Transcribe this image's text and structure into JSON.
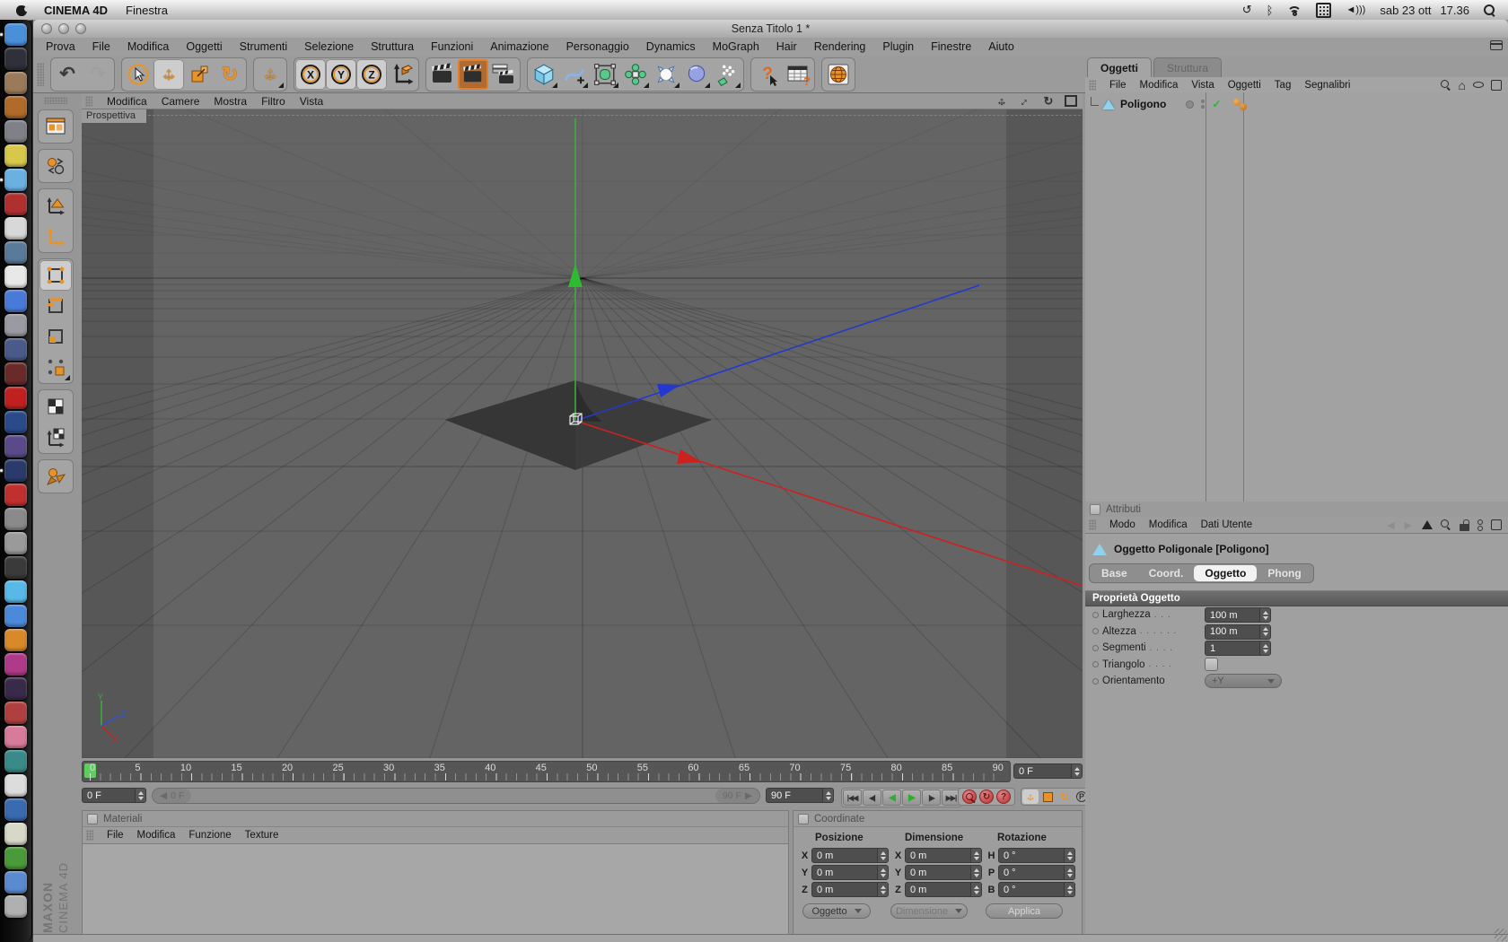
{
  "menubar": {
    "app_name": "CINEMA 4D",
    "menu": "Finestra",
    "date": "sab 23 ott",
    "time": "17.36"
  },
  "window": {
    "title": "Senza Titolo 1 *"
  },
  "main_menu": [
    "Prova",
    "File",
    "Modifica",
    "Oggetti",
    "Strumenti",
    "Selezione",
    "Struttura",
    "Funzioni",
    "Animazione",
    "Personaggio",
    "Dynamics",
    "MoGraph",
    "Hair",
    "Rendering",
    "Plugin",
    "Finestre",
    "Aiuto"
  ],
  "viewport": {
    "menu": [
      "Modifica",
      "Camere",
      "Mostra",
      "Filtro",
      "Vista"
    ],
    "label": "Prospettiva",
    "axis": {
      "x": "X",
      "y": "Y",
      "z": "Z"
    }
  },
  "timeline": {
    "ticks": [
      "0",
      "5",
      "10",
      "15",
      "20",
      "25",
      "30",
      "35",
      "40",
      "45",
      "50",
      "55",
      "60",
      "65",
      "70",
      "75",
      "80",
      "85",
      "90"
    ],
    "frame_field": "0 F",
    "current": "0 F",
    "slider_start": "0 F",
    "slider_end": "90 F",
    "end_field": "90 F",
    "transport": [
      {
        "name": "goto-start-button",
        "g": "|◀◀"
      },
      {
        "name": "previous-key-button",
        "g": "◀|"
      },
      {
        "name": "play-backwards-button",
        "g": "◀",
        "cls": "green"
      },
      {
        "name": "play-forwards-button",
        "g": "▶",
        "cls": "green"
      },
      {
        "name": "next-key-button",
        "g": "|▶"
      },
      {
        "name": "goto-end-button",
        "g": "▶▶|"
      }
    ]
  },
  "materials_panel": {
    "title": "Materiali",
    "menu": [
      "File",
      "Modifica",
      "Funzione",
      "Texture"
    ]
  },
  "coordinates_panel": {
    "title": "Coordinate",
    "headers": [
      "Posizione",
      "Dimensione",
      "Rotazione"
    ],
    "rows": [
      {
        "a": "X",
        "av": "0 m",
        "b": "X",
        "bv": "0 m",
        "c": "H",
        "cv": "0 °"
      },
      {
        "a": "Y",
        "av": "0 m",
        "b": "Y",
        "bv": "0 m",
        "c": "P",
        "cv": "0 °"
      },
      {
        "a": "Z",
        "av": "0 m",
        "b": "Z",
        "bv": "0 m",
        "c": "B",
        "cv": "0 °"
      }
    ],
    "buttons": {
      "object": "Oggetto",
      "dimension": "Dimensione",
      "apply": "Applica"
    }
  },
  "object_manager": {
    "tab_objects": "Oggetti",
    "tab_structure": "Struttura",
    "menu": [
      "File",
      "Modifica",
      "Vista",
      "Oggetti",
      "Tag",
      "Segnalibri"
    ],
    "object_name": "Poligono"
  },
  "attributes_panel": {
    "title": "Attributi",
    "menu": [
      "Modo",
      "Modifica",
      "Dati Utente"
    ],
    "object_title": "Oggetto Poligonale [Poligono]",
    "tabs": [
      "Base",
      "Coord.",
      "Oggetto",
      "Phong"
    ],
    "active_tab": "Oggetto",
    "section": "Proprietà Oggetto",
    "props": [
      {
        "label": "Larghezza",
        "leader": ". . .",
        "value": "100 m"
      },
      {
        "label": "Altezza",
        "leader": ". . . . . .",
        "value": "100 m"
      },
      {
        "label": "Segmenti",
        "leader": ". . . .",
        "value": "1"
      },
      {
        "label": "Triangolo",
        "leader": ". . . .",
        "value": ""
      },
      {
        "label": "Orientamento",
        "leader": "",
        "value": "+Y"
      }
    ]
  },
  "branding": {
    "maxon": "MAXON",
    "product": "CINEMA 4D"
  },
  "icons": {
    "undo": "↶",
    "redo": "↷",
    "rotate": "↻",
    "x": "X",
    "y": "Y",
    "z": "Z",
    "p": "P",
    "question": "?",
    "check": "✓",
    "home": "⌂",
    "left": "◀",
    "right": "▶",
    "left_right": "↔",
    "up_down": "↕",
    "timemachine": "↺",
    "bluetooth": "ᛒ",
    "volume": "◄)))"
  },
  "colors": {
    "accent_orange": "#e8932a",
    "axis_x_red": "#cf2020",
    "axis_y_green": "#3fae3f",
    "axis_z_blue": "#2438d0",
    "marker_green": "#5ecf5e",
    "viewport_bg": "#646464"
  },
  "dock": {
    "items": [
      {
        "name": "finder",
        "color": "#4a90d9",
        "running": true
      },
      {
        "name": "photo-viewer",
        "color": "#30303a"
      },
      {
        "name": "contacts",
        "color": "#9a7a58"
      },
      {
        "name": "photos",
        "color": "#b06a2a"
      },
      {
        "name": "star-app",
        "color": "#808088"
      },
      {
        "name": "stickies",
        "color": "#d8c84a"
      },
      {
        "name": "safari",
        "color": "#6ab0e0",
        "running": true
      },
      {
        "name": "pokerstars",
        "color": "#b03030"
      },
      {
        "name": "dice-app",
        "color": "#d8d8d8"
      },
      {
        "name": "travel-app",
        "color": "#5a7a9a"
      },
      {
        "name": "calendar",
        "color": "#e8e8e8"
      },
      {
        "name": "quicktime",
        "color": "#4a7ad8"
      },
      {
        "name": "design-app",
        "color": "#9a9aa2"
      },
      {
        "name": "film-app",
        "color": "#4a5a8a"
      },
      {
        "name": "heater-app",
        "color": "#6a2a2a"
      },
      {
        "name": "acrobat",
        "color": "#c02020"
      },
      {
        "name": "photoshop",
        "color": "#2a4a8a"
      },
      {
        "name": "after-effects",
        "color": "#5a4a8a"
      },
      {
        "name": "browser",
        "color": "#2a3a6a",
        "running": true
      },
      {
        "name": "red-app",
        "color": "#c03030"
      },
      {
        "name": "zbrush",
        "color": "#8a8a8a"
      },
      {
        "name": "modeling-app",
        "color": "#9a9a9a"
      },
      {
        "name": "video-app",
        "color": "#3a3a3a"
      },
      {
        "name": "skype",
        "color": "#58b8e8"
      },
      {
        "name": "itunes",
        "color": "#4a8ad8"
      },
      {
        "name": "folder-orange",
        "color": "#d88a2a"
      },
      {
        "name": "folder-magenta",
        "color": "#b03a8a"
      },
      {
        "name": "magic-app",
        "color": "#3a2a4a"
      },
      {
        "name": "dvd-app",
        "color": "#b04040"
      },
      {
        "name": "tools-pink",
        "color": "#d87a9a"
      },
      {
        "name": "terminal-app",
        "color": "#3a8a8a"
      },
      {
        "name": "scissors-app",
        "color": "#dcdcdc"
      },
      {
        "name": "vmware",
        "color": "#3a6ab0"
      },
      {
        "name": "notes-app",
        "color": "#d8d8c8"
      },
      {
        "name": "sketch-app",
        "color": "#4a9a3a"
      },
      {
        "name": "folder",
        "color": "#5a8ad0"
      },
      {
        "name": "trash",
        "color": "#b0b0b0"
      }
    ]
  }
}
